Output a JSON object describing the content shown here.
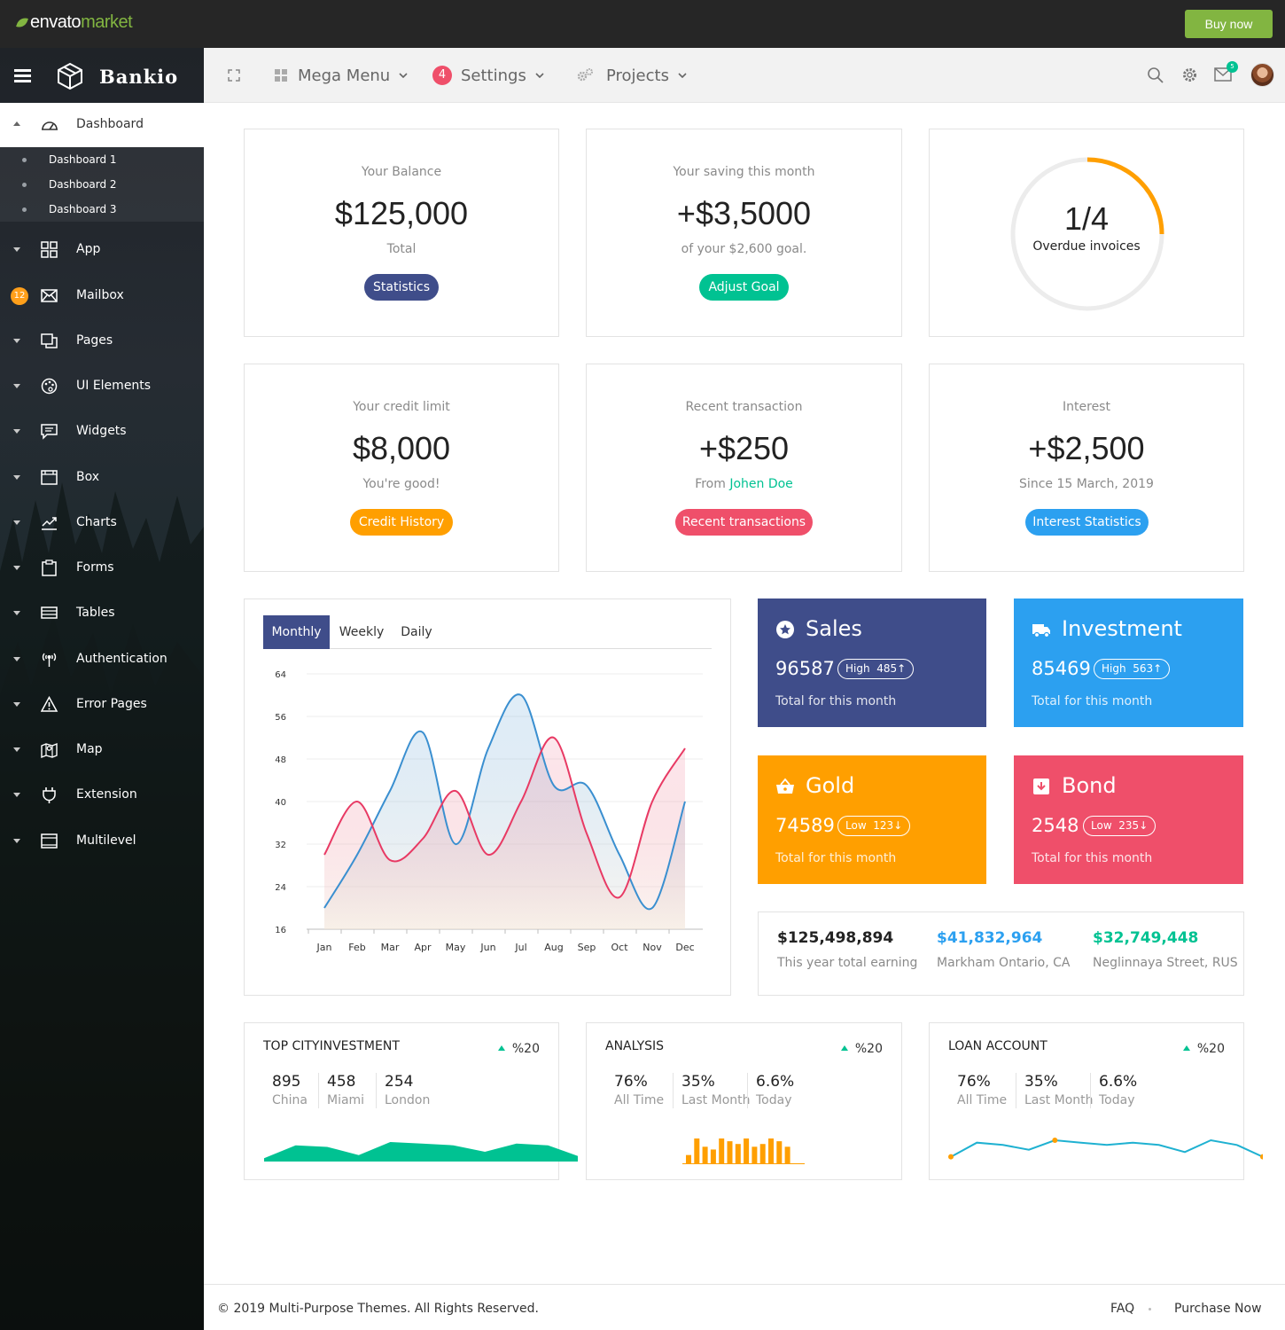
{
  "topbar": {
    "logo_part1": "envato",
    "logo_part2": "market",
    "buy_label": "Buy now"
  },
  "brand": {
    "name": "Bankio"
  },
  "sidebar": {
    "active": {
      "label": "Dashboard"
    },
    "sub_items": [
      "Dashboard 1",
      "Dashboard 2",
      "Dashboard 3"
    ],
    "items": [
      {
        "label": "App",
        "icon": "grid-icon"
      },
      {
        "label": "Mailbox",
        "icon": "mail-icon",
        "badge": "12"
      },
      {
        "label": "Pages",
        "icon": "pages-icon"
      },
      {
        "label": "UI Elements",
        "icon": "palette-icon"
      },
      {
        "label": "Widgets",
        "icon": "chat-icon"
      },
      {
        "label": "Box",
        "icon": "box-icon"
      },
      {
        "label": "Charts",
        "icon": "chart-icon"
      },
      {
        "label": "Forms",
        "icon": "clipboard-icon"
      },
      {
        "label": "Tables",
        "icon": "table-icon"
      },
      {
        "label": "Authentication",
        "icon": "antenna-icon"
      },
      {
        "label": "Error Pages",
        "icon": "warning-icon"
      },
      {
        "label": "Map",
        "icon": "map-icon"
      },
      {
        "label": "Extension",
        "icon": "plug-icon"
      },
      {
        "label": "Multilevel",
        "icon": "window-icon"
      }
    ]
  },
  "header": {
    "mega_menu": "Mega Menu",
    "settings": "Settings",
    "settings_badge": "4",
    "projects": "Projects",
    "mail_badge": "5"
  },
  "stats": [
    {
      "caption": "Your Balance",
      "value": "$125,000",
      "sub": "Total",
      "button": "Statistics",
      "color": "#3f4d8a"
    },
    {
      "caption": "Your saving this month",
      "value": "+$3,5000",
      "sub": "of your $2,600 goal.",
      "button": "Adjust Goal",
      "color": "#00c292"
    },
    {
      "caption": "Your credit limit",
      "value": "$8,000",
      "sub": "You're good!",
      "button": "Credit History",
      "color": "#ff9f00"
    },
    {
      "caption": "Recent transaction",
      "value": "+$250",
      "sub_prefix": "From ",
      "sub_link": "Johen Doe",
      "button": "Recent transactions",
      "color": "#ef4f6a"
    },
    {
      "caption": "Interest",
      "value": "+$2,500",
      "sub": "Since 15 March, 2019",
      "button": "Interest Statistics",
      "color": "#2ca0f0"
    }
  ],
  "overdue": {
    "value": "1/4",
    "label": "Overdue invoices",
    "fraction": 0.25,
    "color": "#ff9f00"
  },
  "chart_tabs": [
    "Monthly",
    "Weekly",
    "Daily"
  ],
  "chart_data": {
    "type": "area",
    "categories": [
      "Jan",
      "Feb",
      "Mar",
      "Apr",
      "May",
      "Jun",
      "Jul",
      "Aug",
      "Sep",
      "Oct",
      "Nov",
      "Dec"
    ],
    "ylim": [
      16,
      64
    ],
    "yticks": [
      16,
      24,
      32,
      40,
      48,
      56,
      64
    ],
    "series": [
      {
        "values": [
          20,
          30,
          42,
          53,
          32,
          50,
          60,
          43,
          43,
          30,
          20,
          40
        ],
        "color": "#3a8fd0"
      },
      {
        "values": [
          30,
          40,
          29,
          33,
          42,
          30,
          40,
          52,
          34,
          22,
          40,
          50
        ],
        "color": "#e83a64"
      }
    ]
  },
  "tiles": [
    {
      "title": "Sales",
      "icon": "star-icon",
      "value": "96587",
      "level": "High",
      "level_value": "485",
      "arrow": "↑",
      "total": "Total for this month",
      "color": "#3f4d8a"
    },
    {
      "title": "Investment",
      "icon": "truck-icon",
      "value": "85469",
      "level": "High",
      "level_value": "563",
      "arrow": "↑",
      "total": "Total for this month",
      "color": "#2ca0f0"
    },
    {
      "title": "Gold",
      "icon": "basket-icon",
      "value": "74589",
      "level": "Low",
      "level_value": "123",
      "arrow": "↓",
      "total": "Total for this month",
      "color": "#ff9f00"
    },
    {
      "title": "Bond",
      "icon": "archive-icon",
      "value": "2548",
      "level": "Low",
      "level_value": "235",
      "arrow": "↓",
      "total": "Total for this month",
      "color": "#ef4f6a"
    }
  ],
  "earnings": [
    {
      "value": "$125,498,894",
      "caption": "This year total earning",
      "color": "#222222"
    },
    {
      "value": "$41,832,964",
      "caption": "Markham Ontario, CA",
      "color": "#2ca0f0"
    },
    {
      "value": "$32,749,448",
      "caption": "Neglinnaya Street, RUS",
      "color": "#00c292"
    }
  ],
  "mini_cards": [
    {
      "title": "TOP CITYINVESTMENT",
      "pct": "%20",
      "cols": [
        {
          "v": "895",
          "l": "China"
        },
        {
          "v": "458",
          "l": "Miami"
        },
        {
          "v": "254",
          "l": "London"
        }
      ],
      "spark": {
        "type": "area",
        "values": [
          2,
          10,
          9,
          4,
          12,
          11,
          10,
          6,
          11,
          10,
          3
        ],
        "color": "#00c292"
      }
    },
    {
      "title": "ANALYSIS",
      "pct": "%20",
      "cols": [
        {
          "v": "76%",
          "l": "All Time"
        },
        {
          "v": "35%",
          "l": "Last Month"
        },
        {
          "v": "6.6%",
          "l": "Today"
        }
      ],
      "spark": {
        "type": "bar",
        "values": [
          3,
          9,
          6,
          5,
          9,
          8,
          7,
          9,
          6,
          7,
          9,
          8,
          6
        ],
        "color": "#ff9f00"
      }
    },
    {
      "title": "LOAN ACCOUNT",
      "pct": "%20",
      "cols": [
        {
          "v": "76%",
          "l": "All Time"
        },
        {
          "v": "35%",
          "l": "Last Month"
        },
        {
          "v": "6.6%",
          "l": "Today"
        }
      ],
      "spark": {
        "type": "line",
        "values": [
          2,
          8,
          7,
          5,
          9,
          8,
          7,
          8,
          7,
          4,
          9,
          7,
          2
        ],
        "color": "#1fb1d1"
      }
    }
  ],
  "footer": {
    "copyright": "© 2019 Multi-Purpose Themes. All Rights Reserved.",
    "faq": "FAQ",
    "purchase": "Purchase Now"
  }
}
